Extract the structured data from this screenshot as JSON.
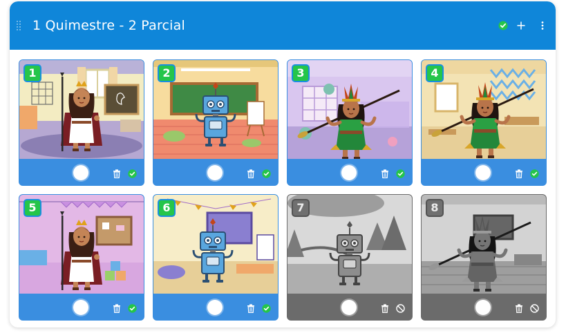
{
  "header": {
    "title": "1 Quimestre - 2 Parcial",
    "status_icon": "check-circle-icon",
    "add_icon": "plus-icon",
    "menu_icon": "more-vertical-icon",
    "color": "#0f86d9"
  },
  "colors": {
    "card_active": "#3a8ee0",
    "card_locked": "#6b6b6b",
    "badge_active": "#25c54a",
    "badge_locked": "#7a7a7a",
    "status_ok": "#25c54a"
  },
  "cards": [
    {
      "number": "1",
      "scene": "princess-classroom",
      "state": "completed"
    },
    {
      "number": "2",
      "scene": "robot-classroom",
      "state": "completed"
    },
    {
      "number": "3",
      "scene": "warrior-playroom",
      "state": "completed"
    },
    {
      "number": "4",
      "scene": "warrior-classroom",
      "state": "completed"
    },
    {
      "number": "5",
      "scene": "princess-playroom",
      "state": "completed"
    },
    {
      "number": "6",
      "scene": "robot-party-room",
      "state": "completed"
    },
    {
      "number": "7",
      "scene": "robot-forest",
      "state": "locked"
    },
    {
      "number": "8",
      "scene": "warrior-room",
      "state": "locked"
    }
  ]
}
